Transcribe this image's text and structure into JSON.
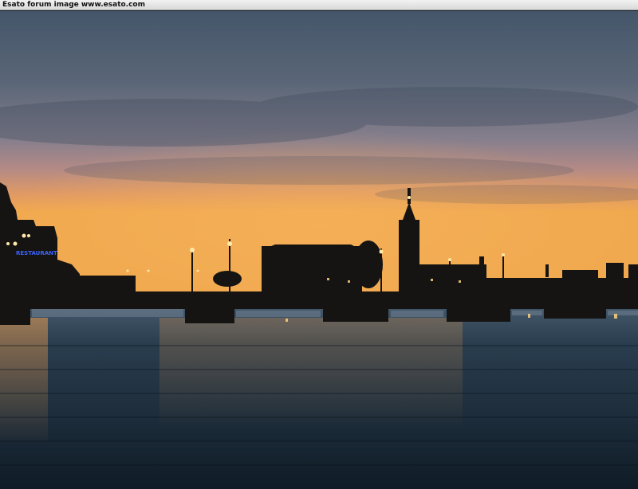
{
  "banner": {
    "text": "Esato forum image www.esato.com"
  },
  "photo": {
    "subject": "Stockholm City Hall skyline at sunset across the water with a bridge",
    "sign_text": "RESTAURANT",
    "colors": {
      "sky_top": "#47576a",
      "sky_mid": "#8a8796",
      "horizon_glow": "#f0a24f",
      "silhouette": "#151412",
      "water": "#1a2a38",
      "sign_blue": "#3a63ff",
      "lamp": "#ffe9a8"
    }
  }
}
